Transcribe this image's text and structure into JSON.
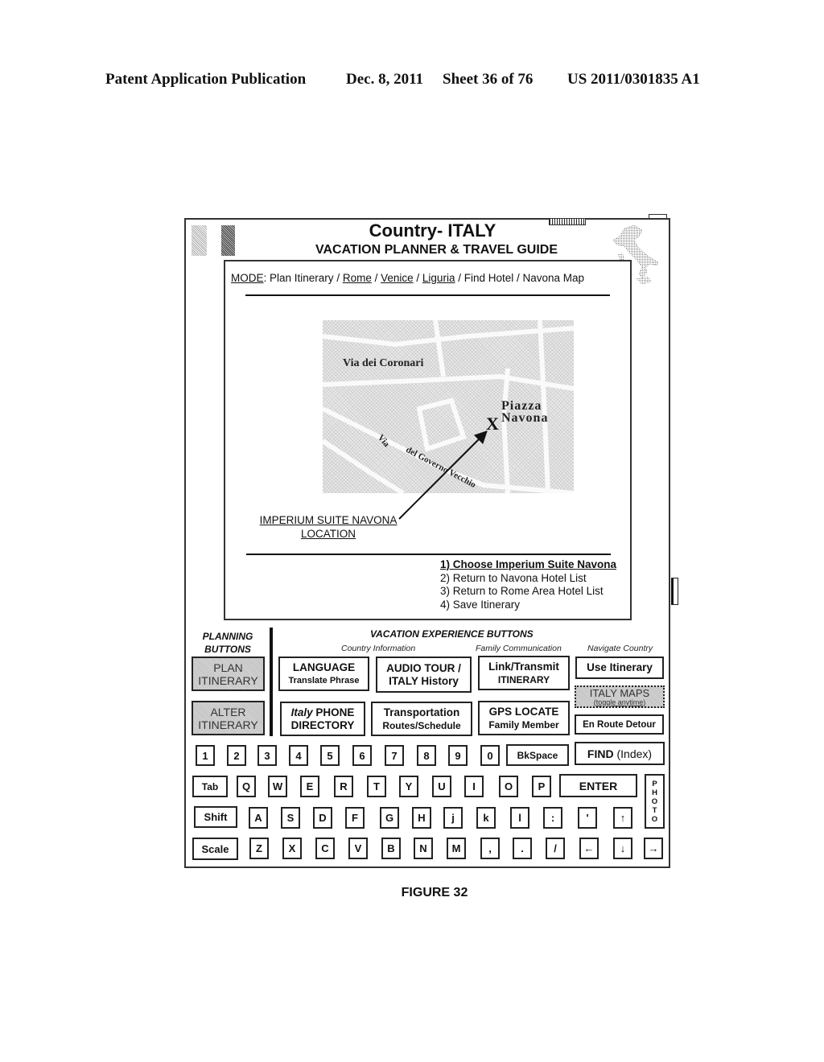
{
  "patent_header": {
    "publication": "Patent Application Publication",
    "date": "Dec. 8, 2011",
    "sheet": "Sheet 36 of 76",
    "number": "US 2011/0301835 A1"
  },
  "device": {
    "title": "Country- ITALY",
    "subtitle": "VACATION PLANNER & TRAVEL GUIDE",
    "icons": [
      "italy-flag-icon",
      "speaker-grille-icon",
      "italy-map-icon"
    ]
  },
  "mode_bar": {
    "label": "MODE",
    "separator": ": ",
    "crumbs": [
      {
        "text": "Plan Itinerary",
        "underlined": false
      },
      {
        "text": "Rome",
        "underlined": true
      },
      {
        "text": "Venice",
        "underlined": true
      },
      {
        "text": "Liguria",
        "underlined": true
      },
      {
        "text": "Find Hotel",
        "underlined": false
      },
      {
        "text": "Navona Map",
        "underlined": false
      }
    ],
    "divider": " / "
  },
  "map": {
    "street_1": "Via dei Coronari",
    "street_2a": "Via",
    "street_2b": "del Governo Vecchio",
    "square_1": "Piazza",
    "square_2": "Navona",
    "marker": "X"
  },
  "location_label": {
    "line1": "IMPERIUM SUITE NAVONA",
    "line2": "LOCATION"
  },
  "options": [
    {
      "text": "1) Choose Imperium Suite Navona",
      "selected": true
    },
    {
      "text": "2) Return to Navona Hotel List",
      "selected": false
    },
    {
      "text": "3) Return to Rome Area Hotel List",
      "selected": false
    },
    {
      "text": "4) Save Itinerary",
      "selected": false
    }
  ],
  "planning": {
    "label_line1": "PLANNING",
    "label_line2": "BUTTONS",
    "buttons": [
      {
        "line1": "PLAN",
        "line2": "ITINERARY"
      },
      {
        "line1": "ALTER",
        "line2": "ITINERARY"
      }
    ]
  },
  "vacation": {
    "label": "VACATION EXPERIENCE BUTTONS",
    "categories": [
      "Country Information",
      "Family Communication",
      "Navigate Country"
    ],
    "buttons": {
      "language": {
        "line1": "LANGUAGE",
        "line2": "Translate Phrase"
      },
      "audio_tour": {
        "line1": "AUDIO TOUR /",
        "line2": "ITALY History"
      },
      "link_transmit": {
        "line1": "Link/Transmit",
        "line2": "ITINERARY"
      },
      "use_itinerary": {
        "line1": "Use Itinerary"
      },
      "italy_maps": {
        "line1": "ITALY MAPS",
        "line2": "(toggle anytime)"
      },
      "phone_directory": {
        "italic": "Italy",
        "line1": " PHONE",
        "line2": "DIRECTORY"
      },
      "transportation": {
        "line1": "Transportation",
        "line2": "Routes/Schedule"
      },
      "gps_locate": {
        "line1": "GPS LOCATE",
        "line2": "Family Member"
      },
      "en_route": {
        "line1": "En Route Detour"
      }
    }
  },
  "keyboard": {
    "row1": [
      "1",
      "2",
      "3",
      "4",
      "5",
      "6",
      "7",
      "8",
      "9",
      "0"
    ],
    "bkspace": "BkSpace",
    "find_bold": "FIND",
    "find_rest": " (Index)",
    "tab": "Tab",
    "row2": [
      "Q",
      "W",
      "E",
      "R",
      "T",
      "Y",
      "U",
      "I",
      "O",
      "P"
    ],
    "enter": "ENTER",
    "photo": [
      "P",
      "H",
      "O",
      "T",
      "O"
    ],
    "shift": "Shift",
    "row3": [
      "A",
      "S",
      "D",
      "F",
      "G",
      "H",
      "j",
      "k",
      "l",
      ":",
      "'",
      "↑"
    ],
    "scale": "Scale",
    "row4": [
      "Z",
      "X",
      "C",
      "V",
      "B",
      "N",
      "M",
      ",",
      ".",
      "/",
      "←",
      "↓",
      "→"
    ]
  },
  "figure_label": "FIGURE 32"
}
